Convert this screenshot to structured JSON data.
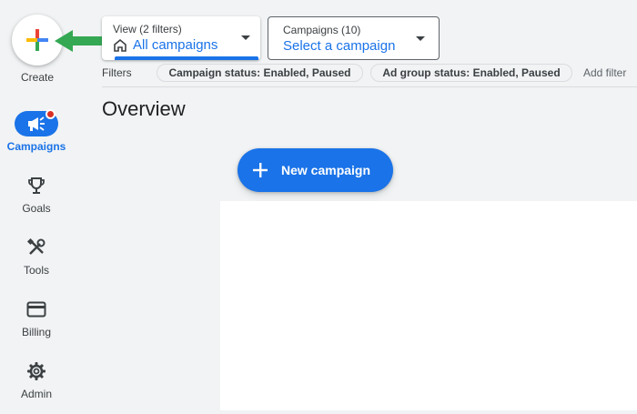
{
  "nav": {
    "create_label": "Create",
    "items": [
      {
        "label": "Campaigns",
        "icon": "megaphone-icon",
        "active": true
      },
      {
        "label": "Goals",
        "icon": "trophy-icon"
      },
      {
        "label": "Tools",
        "icon": "tools-icon"
      },
      {
        "label": "Billing",
        "icon": "credit-card-icon"
      },
      {
        "label": "Admin",
        "icon": "gear-icon"
      }
    ]
  },
  "view_selector": {
    "caption": "View (2 filters)",
    "value": "All campaigns"
  },
  "campaign_selector": {
    "caption": "Campaigns (10)",
    "value": "Select a campaign"
  },
  "filters": {
    "label": "Filters",
    "chips": [
      "Campaign status: Enabled, Paused",
      "Ad group status: Enabled, Paused"
    ],
    "add_label": "Add filter"
  },
  "page_title": "Overview",
  "new_campaign_label": "New campaign",
  "colors": {
    "primary": "#1a73e8",
    "badge": "#d93025",
    "arrow": "#34a853",
    "background": "#f1f3f4"
  }
}
